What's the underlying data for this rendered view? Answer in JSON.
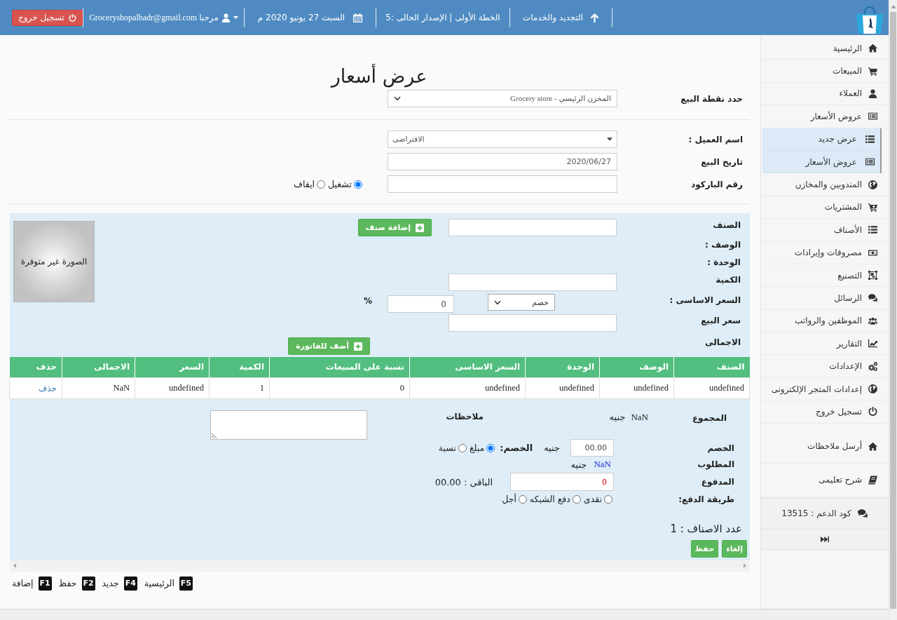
{
  "top_bar": {
    "renewal": "التجديد والخدمات",
    "plan": "الخطة الأولى | الإصدار الحالى :5",
    "date": "السبت 27 يونيو 2020 م",
    "user": "مرحبا Groceryshopalbadr@gmail.com",
    "logout": "تسجيل خروج"
  },
  "sidebar": {
    "items": [
      {
        "label": "الرئيسية"
      },
      {
        "label": "المبيعات"
      },
      {
        "label": "العملاء"
      },
      {
        "label": "عروض الأسعار",
        "children": [
          {
            "label": "عرض جديد"
          },
          {
            "label": "عروض الأسعار"
          }
        ]
      },
      {
        "label": "المندوبين والمخازن"
      },
      {
        "label": "المشتريات"
      },
      {
        "label": "الأصناف"
      },
      {
        "label": "مصروفات وإيرادات"
      },
      {
        "label": "التصنيع"
      },
      {
        "label": "الرسائل"
      },
      {
        "label": "الموظفين والرواتب"
      },
      {
        "label": "التقارير"
      },
      {
        "label": "الإعدادات"
      },
      {
        "label": "إعدادات المتجر الإلكترونى"
      },
      {
        "label": "تسجيل خروج"
      }
    ],
    "extra_items": [
      {
        "label": "أرسل ملاحظات"
      },
      {
        "label": "شرح تعليمى"
      }
    ],
    "support_code": "كود الدعم : 13515"
  },
  "title": "عرض أسعار",
  "point_of_sale": {
    "label": "حدد نقطة البيع",
    "value": "المخزن الرئيسي - Grocery store"
  },
  "customer_fields": [
    {
      "kind": "select",
      "label": "اسم العميل :",
      "value": "الافتراضى"
    },
    {
      "kind": "input",
      "label": "تاريخ البيع",
      "value": "2020/06/27"
    },
    {
      "kind": "input",
      "label": "رقم الباركود",
      "options": [
        {
          "label": "تشغيل",
          "selected": true
        },
        {
          "label": "ايقاف",
          "selected": false
        }
      ]
    }
  ],
  "item_form": {
    "rows": [
      {
        "kind": "input_button",
        "label": "الصنف",
        "button": "إضافة صنف"
      },
      {
        "kind": "label",
        "label": "الوصف :"
      },
      {
        "kind": "label",
        "label": "الوحدة :"
      },
      {
        "kind": "input",
        "label": "الكمية"
      },
      {
        "kind": "discount",
        "label": "السعر الاساسى :",
        "select": "خصم",
        "value": "0",
        "unit": "%"
      },
      {
        "kind": "input",
        "label": "سعر البيع"
      },
      {
        "kind": "button",
        "label": "الاجمالى",
        "button": "أضف للفاتورة"
      }
    ],
    "image_placeholder": "الصورة غير متوفرة"
  },
  "table": {
    "columns": [
      "الصنف",
      "الوصف",
      "الوحدة",
      "السعر الاساسى",
      "نسبة على المبيعات",
      "الكمية",
      "السعر",
      "الاجمالى",
      "حذف"
    ],
    "rows": [
      {
        "cells": [
          "undefined",
          "undefined",
          "undefined",
          "undefined",
          "0",
          "1",
          "undefined",
          "NaN"
        ],
        "delete": "حذف"
      }
    ]
  },
  "summary": {
    "total": {
      "label": "المجموع",
      "amount": "NaN",
      "currency": "جنيه"
    },
    "notes_label": "ملاحظات",
    "discount": {
      "label": "الخصم",
      "value": "00.00",
      "currency": "جنيه",
      "type_label": "الخصم:",
      "types": [
        {
          "label": "مبلغ",
          "selected": true
        },
        {
          "label": "نسبة",
          "selected": false
        }
      ]
    },
    "required": {
      "label": "المطلوب",
      "amount": "NaN",
      "currency": "جنيه"
    },
    "paid": {
      "label": "المدفوع",
      "value": "0",
      "remaining": "الباقى : 00.00"
    },
    "payment": {
      "label": "طريقة الدفع:",
      "methods": [
        {
          "label": "نقدى",
          "selected": false
        },
        {
          "label": "دفع الشبكه",
          "selected": false
        },
        {
          "label": "أجل",
          "selected": false
        }
      ]
    },
    "item_count": "عدد الاصناف : 1",
    "buttons": [
      "إلغاء",
      "حفظ"
    ]
  },
  "shortcuts": [
    {
      "key": "F5",
      "label": "الرئيسية"
    },
    {
      "key": "F4",
      "label": "جديد"
    },
    {
      "key": "F2",
      "label": "حفظ"
    },
    {
      "key": "F1",
      "label": "إضافة"
    }
  ]
}
